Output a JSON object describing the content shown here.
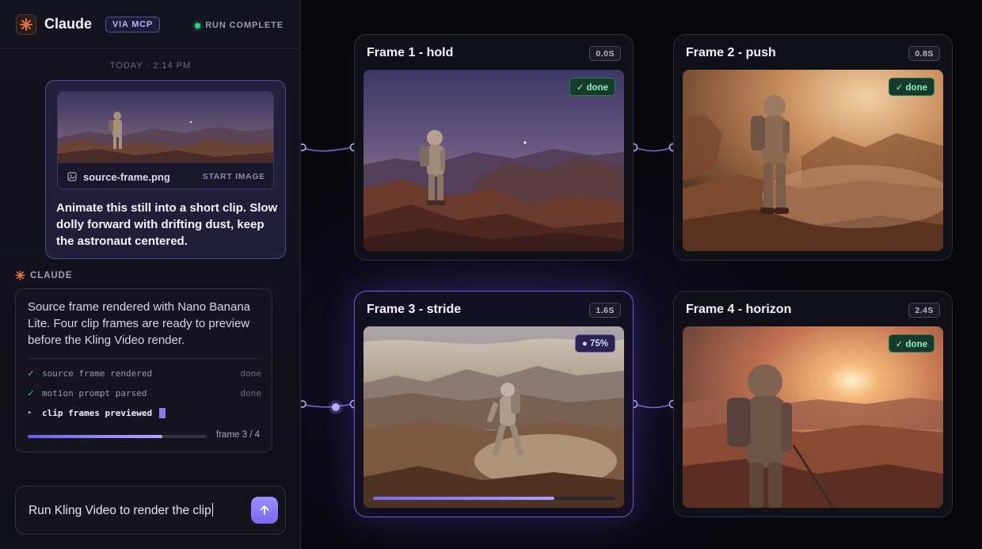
{
  "header": {
    "app_name": "Claude",
    "badge": "VIA MCP",
    "status": "RUN COMPLETE"
  },
  "chat": {
    "timestamp": "TODAY · 2:14 PM",
    "attachment": {
      "filename": "source-frame.png",
      "tag": "START IMAGE"
    },
    "user_message": "Animate this still into a short clip. Slow dolly forward with drifting dust, keep the astronaut centered.",
    "assistant_label": "CLAUDE",
    "assistant_message": "Source frame rendered with Nano Banana Lite. Four clip frames are ready to preview before the Kling Video render.",
    "steps": [
      {
        "label": "source frame rendered",
        "state": "done"
      },
      {
        "label": "motion prompt parsed",
        "state": "done"
      },
      {
        "label": "clip frames previewed",
        "state": ""
      }
    ],
    "progress": 0.75,
    "progress_label": "frame 3 / 4"
  },
  "composer": {
    "value": "Run Kling Video to render the clip"
  },
  "frames": [
    {
      "title": "Frame 1 - hold",
      "time": "0.0S",
      "badge": "✓ done",
      "status": "done"
    },
    {
      "title": "Frame 2 - push",
      "time": "0.8S",
      "badge": "✓ done",
      "status": "done"
    },
    {
      "title": "Frame 3 - stride",
      "time": "1.6S",
      "badge": "● 75%",
      "status": "progress",
      "progress": 0.75
    },
    {
      "title": "Frame 4 - horizon",
      "time": "2.4S",
      "badge": "✓ done",
      "status": "done"
    }
  ],
  "colors": {
    "accent": "#7a69f2",
    "success": "#2fd38a",
    "brand": "#d9643a"
  }
}
